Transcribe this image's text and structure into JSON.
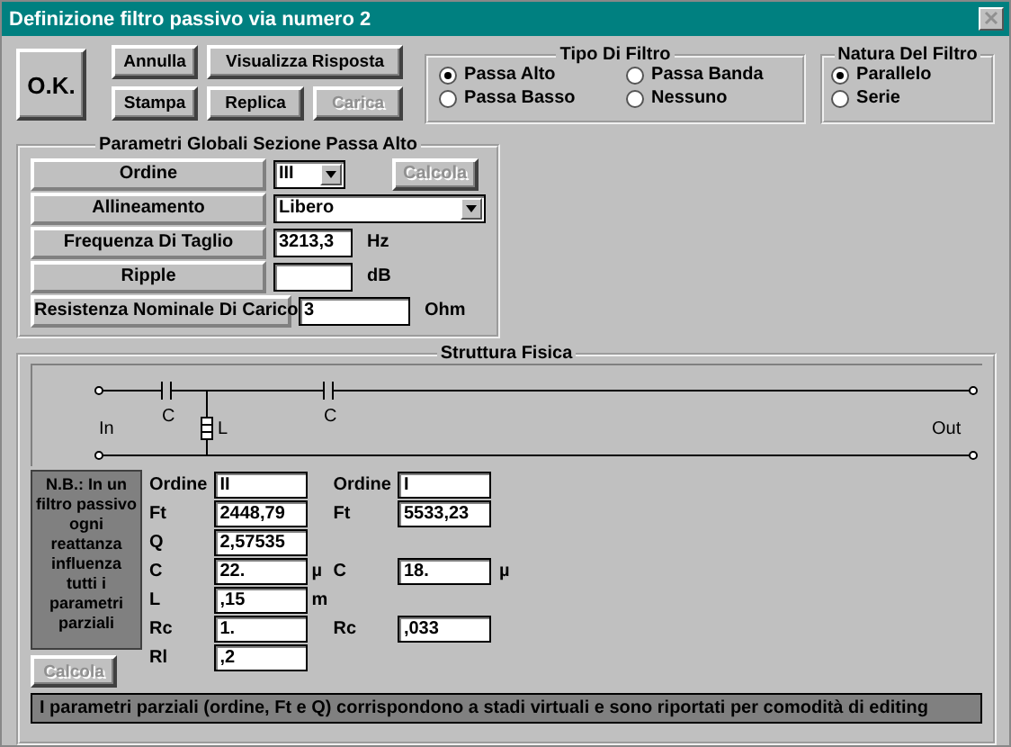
{
  "window": {
    "title": "Definizione filtro passivo via numero 2"
  },
  "buttons": [
    {
      "label": "O.K.",
      "kind": "big",
      "disabled": false
    },
    {
      "label": "Annulla",
      "kind": "small",
      "disabled": false
    },
    {
      "label": "Visualizza Risposta",
      "kind": "small",
      "disabled": false
    },
    {
      "label": "Stampa",
      "kind": "small",
      "disabled": false
    },
    {
      "label": "Replica",
      "kind": "small",
      "disabled": false
    },
    {
      "label": "Carica",
      "kind": "small",
      "disabled": true
    }
  ],
  "filter_type": {
    "title": "Tipo Di Filtro",
    "options": [
      {
        "label": "Passa Alto",
        "selected": true
      },
      {
        "label": "Passa Banda",
        "selected": false
      },
      {
        "label": "Passa Basso",
        "selected": false
      },
      {
        "label": "Nessuno",
        "selected": false
      }
    ]
  },
  "filter_nature": {
    "title": "Natura Del Filtro",
    "options": [
      {
        "label": "Parallelo",
        "selected": true
      },
      {
        "label": "Serie",
        "selected": false
      }
    ]
  },
  "global_params": {
    "title": "Parametri Globali Sezione Passa Alto",
    "rows": [
      {
        "label": "Ordine",
        "kind": "combo",
        "value": "III",
        "action": {
          "label": "Calcola",
          "disabled": true
        }
      },
      {
        "label": "Allineamento",
        "kind": "wide-combo",
        "value": "Libero"
      },
      {
        "label": "Frequenza Di Taglio",
        "kind": "field",
        "value": "3213,3",
        "unit": "Hz"
      },
      {
        "label": "Ripple",
        "kind": "field",
        "value": "",
        "unit": "dB"
      },
      {
        "label": "Resistenza Nominale Di Carico",
        "kind": "field",
        "value": "3",
        "unit": "Ohm"
      }
    ]
  },
  "structure": {
    "title": "Struttura Fisica",
    "circuit_labels": [
      {
        "text": "In"
      },
      {
        "text": "C"
      },
      {
        "text": "L"
      },
      {
        "text": "C"
      },
      {
        "text": "Out"
      }
    ],
    "note": "N.B.: In un filtro passivo ogni reattanza influenza tutti i parametri parziali",
    "partial_rows": [
      {
        "cells": [
          {
            "label": "Ordine",
            "value": "II"
          },
          {
            "label": "Ordine",
            "value": "I"
          }
        ]
      },
      {
        "cells": [
          {
            "label": "Ft",
            "value": "2448,79"
          },
          {
            "label": "Ft",
            "value": "5533,23"
          }
        ]
      },
      {
        "cells": [
          {
            "label": "Q",
            "value": "2,57535"
          }
        ]
      },
      {
        "cells": [
          {
            "label": "C",
            "value": "22.",
            "unit": "µ"
          },
          {
            "label": "C",
            "value": "18.",
            "unit": "µ"
          }
        ]
      },
      {
        "cells": [
          {
            "label": "L",
            "value": ",15",
            "unit": "m"
          }
        ]
      },
      {
        "cells": [
          {
            "label": "Rc",
            "value": "1."
          },
          {
            "label": "Rc",
            "value": ",033"
          }
        ]
      },
      {
        "cells": [
          {
            "label": "Rl",
            "value": ",2"
          }
        ]
      }
    ],
    "calc_button": {
      "label": "Calcola",
      "disabled": true
    },
    "footer": "I parametri parziali (ordine, Ft e Q) corrispondono a stadi virtuali e sono riportati per comodità di editing"
  }
}
